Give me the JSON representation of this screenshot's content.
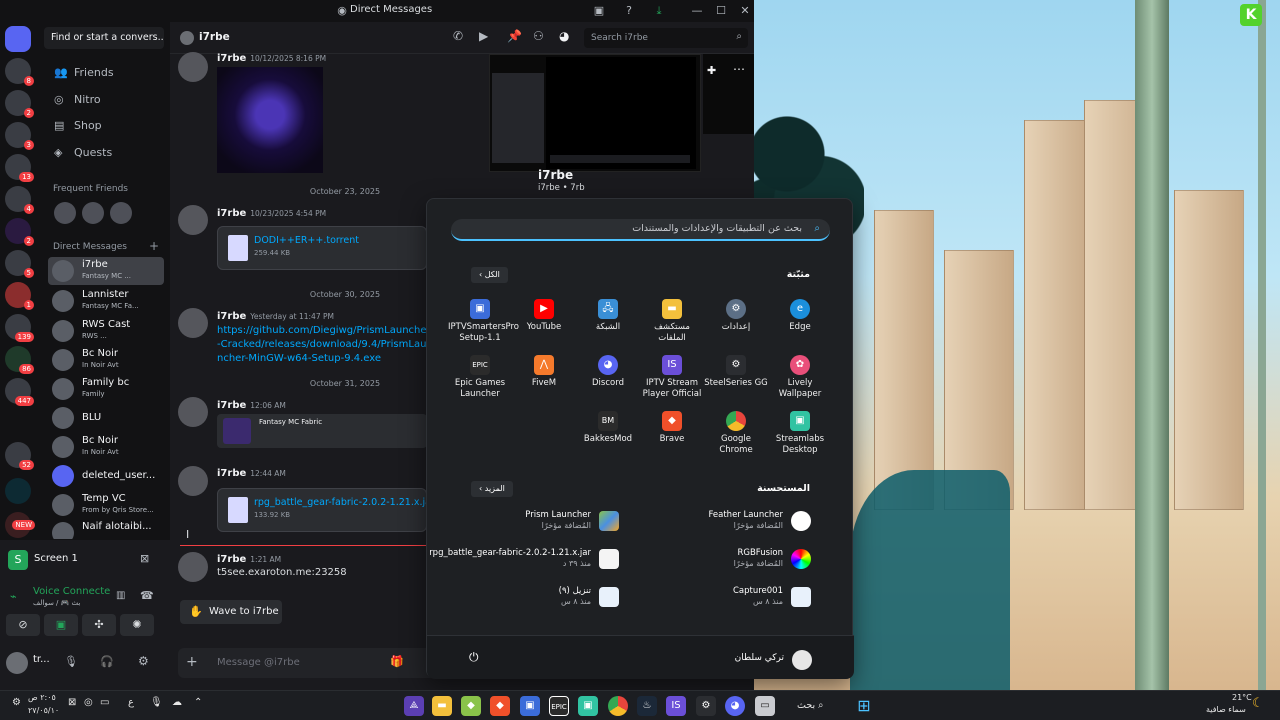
{
  "window": {
    "title": "Direct Messages"
  },
  "channels": {
    "find_placeholder": "Find or start a convers...",
    "nav": [
      {
        "label": "Friends",
        "icon": "friends-icon"
      },
      {
        "label": "Nitro",
        "icon": "nitro-icon"
      },
      {
        "label": "Shop",
        "icon": "shop-icon"
      },
      {
        "label": "Quests",
        "icon": "quests-icon"
      }
    ],
    "frequent_friends_label": "Frequent Friends",
    "direct_messages_label": "Direct Messages",
    "dms": [
      {
        "name": "i7rbe",
        "sub": "Fantasy MC ...",
        "active": true
      },
      {
        "name": "Lannister",
        "sub": "Fantasy MC Fa..."
      },
      {
        "name": "RWS Cast",
        "sub": "RWS ..."
      },
      {
        "name": "Bc Noir",
        "sub": "In Noir Avt"
      },
      {
        "name": "Family bc",
        "sub": "Family"
      },
      {
        "name": "BLU",
        "sub": ""
      },
      {
        "name": "Bc Noir",
        "sub": "In Noir Avt"
      },
      {
        "name": "deleted_user...",
        "sub": ""
      },
      {
        "name": "Temp VC",
        "sub": "From by Qris Store..."
      },
      {
        "name": "Naif alotaibi...",
        "sub": ""
      }
    ],
    "server_badges": [
      "8",
      "2",
      "3",
      "13",
      "4",
      "2",
      "5",
      "1",
      "139",
      "86",
      "447",
      "52",
      "NEW"
    ]
  },
  "voice": {
    "screen_label": "Screen 1",
    "status": "Voice Connecte",
    "sub": "بث 🎮 / سوالف",
    "user_name": "tr..."
  },
  "chat": {
    "recipient": "i7rbe",
    "search_placeholder": "Search i7rbe",
    "messages": [
      {
        "author": "i7rbe",
        "time": "10/12/2025 8:16 PM"
      },
      {
        "author": "i7rbe",
        "time": "10/23/2025 4:54 PM",
        "file_name": "DODI++ER++.torrent",
        "file_size": "259.44 KB"
      },
      {
        "author": "i7rbe",
        "time": "Yesterday at 11:47 PM",
        "link": "https://github.com/Diegiwg/PrismLauncher-Cracked/releases/download/9.4/PrismLauncher-MinGW-w64-Setup-9.4.exe"
      },
      {
        "author": "i7rbe",
        "time": "12:06 AM",
        "embed_title": "Fantasy MC Fabric"
      },
      {
        "author": "i7rbe",
        "time": "12:44 AM",
        "file_name": "rpg_battle_gear-fabric-2.0.2-1.21.x.jar",
        "file_size": "133.92 KB"
      },
      {
        "author": "i7rbe",
        "time": "1:21 AM",
        "text": "t5see.exaroton.me:23258"
      }
    ],
    "dates": [
      "October 23, 2025",
      "October 30, 2025",
      "October 31, 2025"
    ],
    "wave_label": "Wave to i7rbe",
    "composer_placeholder": "Message @i7rbe",
    "profile_name": "i7rbe",
    "profile_sub": "i7rbe • 7rb"
  },
  "start_menu": {
    "search_placeholder": "بحث عن التطبيقات والإعدادات والمستندات",
    "pinned_title": "مثبّتة",
    "all_label": "الكل",
    "recommended_title": "المستحسنة",
    "more_label": "المزيد",
    "pinned": [
      {
        "label": "Edge",
        "color": "#1b8fdc"
      },
      {
        "label": "إعدادات",
        "color": "#5c6f86"
      },
      {
        "label": "مستكشف الملفات",
        "color": "#f3c03c"
      },
      {
        "label": "الشبكة",
        "color": "#3a8fd6"
      },
      {
        "label": "YouTube",
        "color": "#ff0000"
      },
      {
        "label": "IPTVSmartersPro Setup-1.1",
        "color": "#3b6cd9"
      },
      {
        "label": "Lively Wallpaper",
        "color": "#e94f7a"
      },
      {
        "label": "SteelSeries GG",
        "color": "#2b2d31"
      },
      {
        "label": "IPTV Stream Player Official",
        "color": "#6b4fd8"
      },
      {
        "label": "Discord",
        "color": "#5865f2"
      },
      {
        "label": "FiveM",
        "color": "#f57a2c"
      },
      {
        "label": "Epic Games Launcher",
        "color": "#2b2b2b"
      },
      {
        "label": "Streamlabs Desktop",
        "color": "#31c3a2"
      },
      {
        "label": "Google Chrome",
        "color": "#e8453c"
      },
      {
        "label": "Brave",
        "color": "#f0502a"
      },
      {
        "label": "BakkesMod",
        "color": "#2b2b2b"
      }
    ],
    "recommended": [
      {
        "title": "Feather Launcher",
        "sub": "المُضافة مؤخرًا"
      },
      {
        "title": "Prism Launcher",
        "sub": "المُضافة مؤخرًا"
      },
      {
        "title": "RGBFusion",
        "sub": "المُضافة مؤخرًا"
      },
      {
        "title": "rpg_battle_gear-fabric-2.0.2-1.21.x.jar",
        "sub": "منذ ٣٩ د"
      },
      {
        "title": "Capture001",
        "sub": "منذ ٨ س"
      },
      {
        "title": "تنزيل (٩)",
        "sub": "منذ ٨ س"
      }
    ],
    "user_name": "تركي سلطان"
  },
  "taskbar": {
    "search_label": "بحث",
    "weather_temp": "21°C",
    "weather_desc": "سماء صافية",
    "time": "٢:٠٥ ص",
    "date": "٢٧/٠٥/١٠",
    "lang": "ع"
  },
  "colors": {
    "discord_bg": "#1a1a1e",
    "sidebar_bg": "#121214",
    "link": "#00a8fc",
    "accent": "#5865f2",
    "start_bg": "#1e2023"
  }
}
